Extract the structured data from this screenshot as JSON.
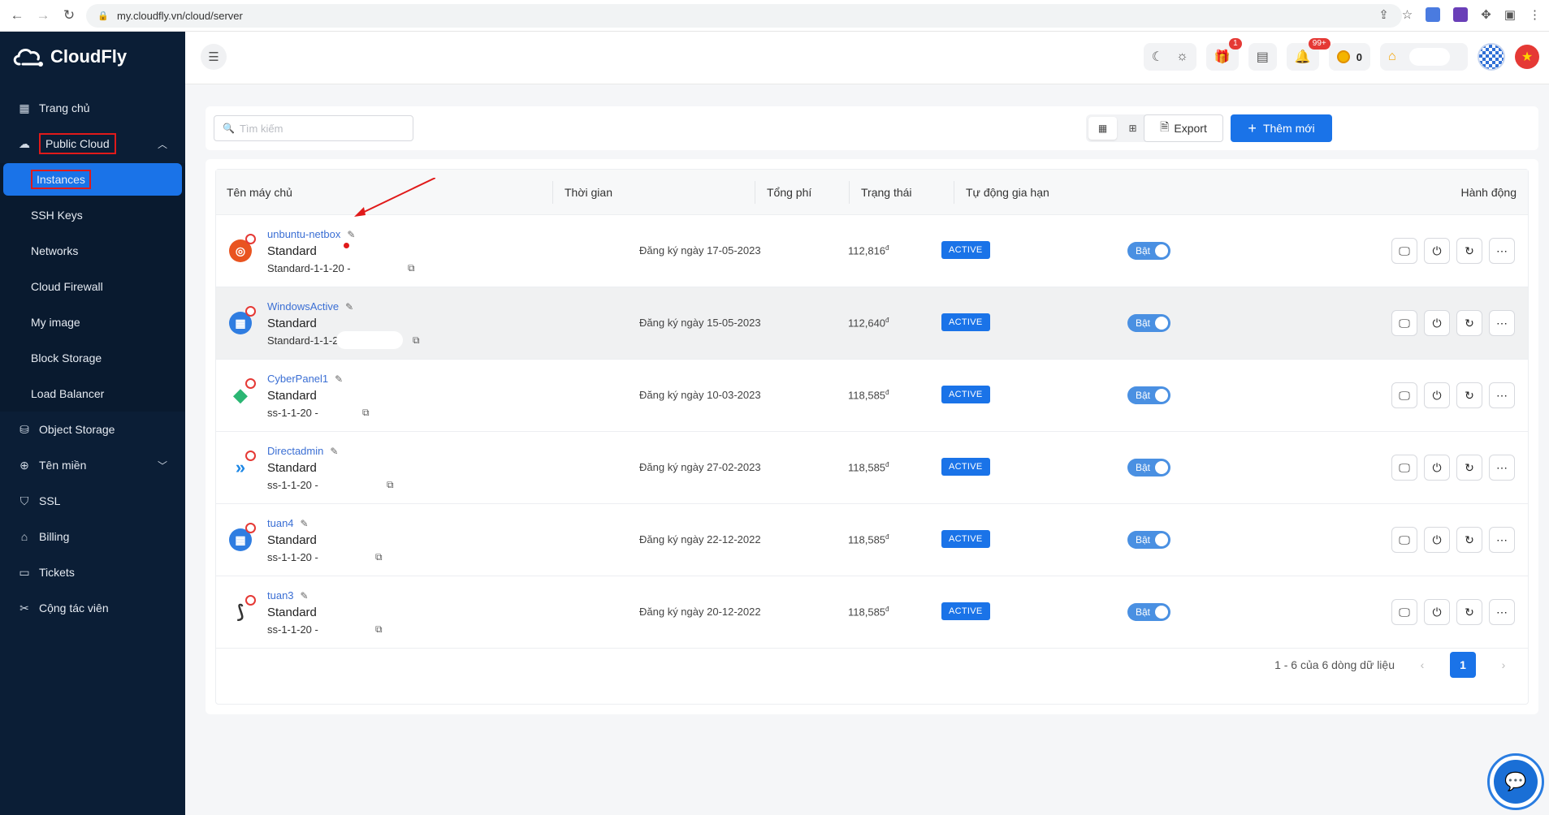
{
  "browser": {
    "url": "my.cloudfly.vn/cloud/server"
  },
  "app": {
    "brand": "CloudFly"
  },
  "sidebar": {
    "items": [
      {
        "label": "Trang chủ"
      },
      {
        "label": "Public Cloud"
      },
      {
        "label": "Object Storage"
      },
      {
        "label": "Tên miền"
      },
      {
        "label": "SSL"
      },
      {
        "label": "Billing"
      },
      {
        "label": "Tickets"
      },
      {
        "label": "Cộng tác viên"
      }
    ],
    "public_cloud_sub": [
      {
        "label": "Instances"
      },
      {
        "label": "SSH Keys"
      },
      {
        "label": "Networks"
      },
      {
        "label": "Cloud Firewall"
      },
      {
        "label": "My image"
      },
      {
        "label": "Block Storage"
      },
      {
        "label": "Load Balancer"
      }
    ]
  },
  "topbar": {
    "gift_badge": "1",
    "notif_badge": "99+",
    "coin_count": "0"
  },
  "toolbar": {
    "search_placeholder": "Tìm kiếm",
    "export_label": "Export",
    "add_label": "Thêm mới"
  },
  "table": {
    "headers": [
      "Tên máy chủ",
      "Thời gian",
      "Tổng phí",
      "Trạng thái",
      "Tự động gia hạn",
      "Hành động"
    ],
    "rows": [
      {
        "name": "unbuntu-netbox",
        "type": "Standard",
        "plan": "Standard-1-1-20 -",
        "time": "Đăng ký ngày 17-05-2023",
        "fee": "112,816",
        "currency": "đ",
        "status": "ACTIVE",
        "auto": "Bật",
        "os": "ubuntu"
      },
      {
        "name": "WindowsActive",
        "type": "Standard",
        "plan": "Standard-1-1-20 -",
        "time": "Đăng ký ngày 15-05-2023",
        "fee": "112,640",
        "currency": "đ",
        "status": "ACTIVE",
        "auto": "Bật",
        "os": "windows"
      },
      {
        "name": "CyberPanel1",
        "type": "Standard",
        "plan": "ss-1-1-20 -",
        "time": "Đăng ký ngày 10-03-2023",
        "fee": "118,585",
        "currency": "đ",
        "status": "ACTIVE",
        "auto": "Bật",
        "os": "cyberpanel"
      },
      {
        "name": "Directadmin",
        "type": "Standard",
        "plan": "ss-1-1-20 -",
        "time": "Đăng ký ngày 27-02-2023",
        "fee": "118,585",
        "currency": "đ",
        "status": "ACTIVE",
        "auto": "Bật",
        "os": "directadmin"
      },
      {
        "name": "tuan4",
        "type": "Standard",
        "plan": "ss-1-1-20 -",
        "time": "Đăng ký ngày 22-12-2022",
        "fee": "118,585",
        "currency": "đ",
        "status": "ACTIVE",
        "auto": "Bật",
        "os": "windows"
      },
      {
        "name": "tuan3",
        "type": "Standard",
        "plan": "ss-1-1-20 -",
        "time": "Đăng ký ngày 20-12-2022",
        "fee": "118,585",
        "currency": "đ",
        "status": "ACTIVE",
        "auto": "Bật",
        "os": "other"
      }
    ]
  },
  "pagination": {
    "summary": "1 - 6 của 6 dòng dữ liệu",
    "current": "1"
  },
  "colors": {
    "sidebar": "#0b1e36",
    "accent": "#1a73e8",
    "highlight_box": "#e01a1a"
  }
}
